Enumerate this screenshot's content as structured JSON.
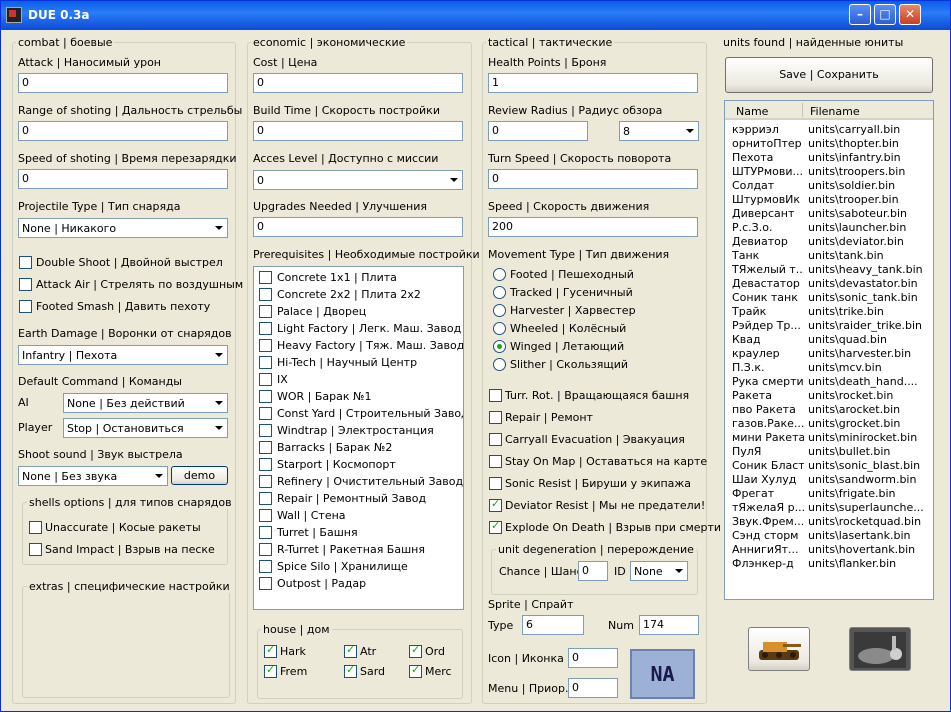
{
  "window": {
    "title": "DUE 0.3a"
  },
  "combat": {
    "group_label": "combat | боевые",
    "attack_label": "Attack | Наносимый урон",
    "attack_value": "0",
    "range_label": "Range of shoting | Дальность стрельбы",
    "range_value": "0",
    "speed_label": "Speed of shoting | Время перезарядки",
    "speed_value": "0",
    "projectile_label": "Projectile Type | Тип снаряда",
    "projectile_value": "None | Никакого",
    "double_shoot": "Double Shoot | Двойной выстрел",
    "attack_air": "Attack Air | Стрелять по воздушным",
    "footed_smash": "Footed Smash | Давить пехоту",
    "earth_label": "Earth Damage | Воронки от снарядов",
    "earth_value": "Infantry | Пехота",
    "default_cmd_label": "Default Command | Команды",
    "ai_label": "AI",
    "ai_value": "None | Без действий",
    "player_label": "Player",
    "player_value": "Stop | Остановиться",
    "shoot_sound_label": "Shoot sound | Звук выстрела",
    "shoot_sound_value": "None | Без звука",
    "demo_button": "demo",
    "shells_label": "shells options | для типов снарядов",
    "unaccurate": "Unaccurate | Косые ракеты",
    "sand_impact": "Sand Impact | Взрыв на песке",
    "extras_label": "extras | специфические настройки"
  },
  "economic": {
    "group_label": "economic | экономические",
    "cost_label": "Cost | Цена",
    "cost_value": "0",
    "build_label": "Build Time | Скорость постройки",
    "build_value": "0",
    "access_label": "Acces Level | Доступно с миссии",
    "access_value": "0",
    "upgrades_label": "Upgrades Needed | Улучшения",
    "upgrades_value": "0",
    "prereq_label": "Prerequisites | Необходимые постройки",
    "prereqs": [
      "Concrete 1x1 | Плита",
      "Concrete 2x2 | Плита 2x2",
      "Palace | Дворец",
      "Light Factory | Легк. Маш. Завод",
      "Heavy Factory | Тяж. Маш. Завод",
      "Hi-Tech | Научный Центр",
      "IX",
      "WOR | Барак №1",
      "Const Yard | Строительный Завод",
      "Windtrap | Электростанция",
      "Barracks | Барак №2",
      "Starport | Космопорт",
      "Refinery | Очистительный Завод",
      "Repair | Ремонтный Завод",
      "Wall | Стена",
      "Turret | Башня",
      "R-Turret | Ракетная Башня",
      "Spice Silo | Хранилище",
      "Outpost | Радар"
    ],
    "house_label": "house | дом",
    "houses": [
      "Hark",
      "Atr",
      "Ord",
      "Frem",
      "Sard",
      "Merc"
    ]
  },
  "tactical": {
    "group_label": "tactical | тактические",
    "health_label": "Health Points | Броня",
    "health_value": "1",
    "review_label": "Review Radius | Радиус обзора",
    "review_value": "0",
    "review_select": "8",
    "turn_label": "Turn Speed | Скорость поворота",
    "turn_value": "0",
    "speed_label": "Speed | Скорость движения",
    "speed_value": "200",
    "movement_label": "Movement Type | Тип движения",
    "movements": [
      "Footed | Пешеходный",
      "Tracked | Гусеничный",
      "Harvester | Харвестер",
      "Wheeled | Колёсный",
      "Winged | Летающий",
      "Slither | Скользящий"
    ],
    "movement_selected": 4,
    "checks": [
      "Turr. Rot. | Вращающаяся башня",
      "Repair | Ремонт",
      "Carryall Evacuation | Эвакуация",
      "Stay On Map | Оставаться на карте",
      "Sonic Resist | Бируши у экипажа",
      "Deviator Resist | Мы не предатели!",
      "Explode On Death | Взрыв при смерти"
    ],
    "degen_label": "unit degeneration | перерождение",
    "chance_label": "Chance | Шанс",
    "chance_value": "0",
    "id_label": "ID",
    "id_value": "None",
    "sprite_label": "Sprite | Спрайт",
    "type_label": "Type",
    "type_value": "6",
    "num_label": "Num",
    "num_value": "174",
    "icon_label": "Icon | Иконка",
    "icon_value": "0",
    "menu_label": "Menu | Приор.",
    "menu_value": "0",
    "na_text": "NA"
  },
  "units": {
    "group_label": "units found | найденные юниты",
    "save_button": "Save | Сохранить",
    "col_name": "Name",
    "col_file": "Filename",
    "rows": [
      [
        "кэрриэл",
        "units\\carryall.bin"
      ],
      [
        "орнитоПтер",
        "units\\thopter.bin"
      ],
      [
        "Пехота",
        "units\\infantry.bin"
      ],
      [
        "ШТУРмови...",
        "units\\troopers.bin"
      ],
      [
        "Солдат",
        "units\\soldier.bin"
      ],
      [
        "ШтурмовИк",
        "units\\trooper.bin"
      ],
      [
        "Диверсант",
        "units\\saboteur.bin"
      ],
      [
        "Р.с.З.о.",
        "units\\launcher.bin"
      ],
      [
        "Девиатор",
        "units\\deviator.bin"
      ],
      [
        "Танк",
        "units\\tank.bin"
      ],
      [
        "ТЯжелый т...",
        "units\\heavy_tank.bin"
      ],
      [
        "Девастатор",
        "units\\devastator.bin"
      ],
      [
        "Соник танк",
        "units\\sonic_tank.bin"
      ],
      [
        "Трайк",
        "units\\trike.bin"
      ],
      [
        "Рэйдер Тр...",
        "units\\raider_trike.bin"
      ],
      [
        "Квад",
        "units\\quad.bin"
      ],
      [
        " краулер",
        "units\\harvester.bin"
      ],
      [
        "П.З.к.",
        "units\\mcv.bin"
      ],
      [
        "Рука смерти",
        "units\\death_hand...."
      ],
      [
        "Ракета",
        "units\\rocket.bin"
      ],
      [
        "пво Ракета",
        "units\\arocket.bin"
      ],
      [
        "газов.Раке...",
        "units\\grocket.bin"
      ],
      [
        "мини Ракета",
        "units\\minirocket.bin"
      ],
      [
        "ПулЯ",
        "units\\bullet.bin"
      ],
      [
        "Соник Бласт",
        "units\\sonic_blast.bin"
      ],
      [
        "Шаи Хулуд",
        "units\\sandworm.bin"
      ],
      [
        "Фрегат",
        "units\\frigate.bin"
      ],
      [
        "тЯжелаЯ р...",
        "units\\superlaunche..."
      ],
      [
        "Звук.Фрем...",
        "units\\rocketquad.bin"
      ],
      [
        "Сэнд сторм",
        "units\\lasertank.bin"
      ],
      [
        " АннигиЯт...",
        "units\\hovertank.bin"
      ],
      [
        "Флэнкер-д",
        "units\\flanker.bin"
      ]
    ]
  }
}
